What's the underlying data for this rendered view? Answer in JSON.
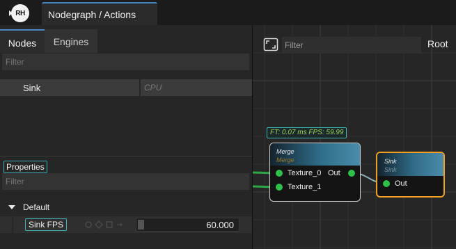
{
  "app": {
    "logo_text": "RH",
    "main_tab": "Nodegraph / Actions"
  },
  "left": {
    "tabs": [
      {
        "label": "Nodes",
        "active": true
      },
      {
        "label": "Engines",
        "active": false
      }
    ],
    "nodes_filter_placeholder": "Filter",
    "node_list": [
      {
        "name": "Sink",
        "engine": "CPU"
      }
    ],
    "properties_label": "Properties",
    "properties_filter_placeholder": "Filter",
    "group_label": "Default",
    "properties": [
      {
        "name": "Sink FPS",
        "value": "60.000"
      }
    ]
  },
  "graph": {
    "filter_placeholder": "Filter",
    "breadcrumb": "Root",
    "ft_badge": "FT: 0.07 ms FPS: 59.99",
    "nodes": {
      "merge": {
        "title": "Merge",
        "subtitle": "Merge",
        "inputs": [
          "Texture_0",
          "Texture_1"
        ],
        "output": "Out"
      },
      "sink": {
        "title": "Sink",
        "subtitle": "Sink",
        "input": "Out"
      }
    },
    "colors": {
      "port": "#2ec04a",
      "selected_border": "#f0a020",
      "accent": "#3fb2b6",
      "tab_accent": "#4a87c4"
    }
  }
}
